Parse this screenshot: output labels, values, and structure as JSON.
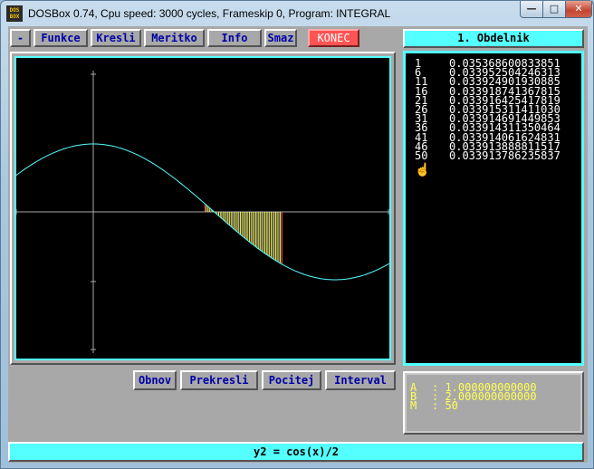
{
  "window": {
    "title": "DOSBox 0.74, Cpu speed:     3000 cycles, Frameskip  0, Program: INTEGRAL",
    "icon_text": "DOS BOX",
    "minimize_label": "—",
    "maximize_label": "□",
    "close_label": "✕"
  },
  "menu": {
    "items": [
      "-",
      "Funkce",
      "Kresli",
      "Meritko",
      "Info",
      "Smaz"
    ],
    "exit_label": "KONEC"
  },
  "method_title": "1. Obdelnik",
  "results": [
    {
      "n": "1",
      "value": "0.035368600833851"
    },
    {
      "n": "6",
      "value": "0.033952504246313"
    },
    {
      "n": "11",
      "value": "0.033924901930885"
    },
    {
      "n": "16",
      "value": "0.033918741367815"
    },
    {
      "n": "21",
      "value": "0.033916425417819"
    },
    {
      "n": "26",
      "value": "0.033915311411030"
    },
    {
      "n": "31",
      "value": "0.033914691449853"
    },
    {
      "n": "36",
      "value": "0.033914311350464"
    },
    {
      "n": "41",
      "value": "0.033914061624831"
    },
    {
      "n": "46",
      "value": "0.033913888811517"
    },
    {
      "n": "50",
      "value": "0.033913786235837"
    }
  ],
  "actions": [
    "Obnov",
    "Prekresli",
    "Pocitej",
    "Interval"
  ],
  "params": [
    {
      "key": "A",
      "value": ": 1.000000000000"
    },
    {
      "key": "B",
      "value": ": 2.000000000000"
    },
    {
      "key": "M",
      "value": ": 50"
    }
  ],
  "function_label": "y2 = cos(x)/2",
  "graph": {
    "function": "cos(x)/2",
    "interval": [
      1,
      2
    ],
    "subdivisions": 50,
    "curve_color": "#54ffff",
    "strip_color": "#ffff54",
    "axis_color": "#a8a8a8",
    "cursor_icon": "hand-cursor-icon"
  }
}
